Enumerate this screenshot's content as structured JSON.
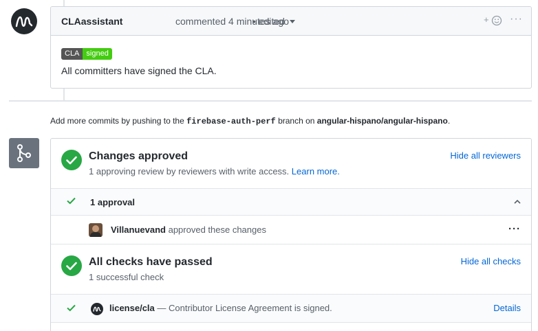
{
  "comment": {
    "author": "CLAassistant",
    "meta": "commented 4 minutes ago",
    "edited": "• edited",
    "badge_left": "CLA",
    "badge_right": "signed",
    "body": "All committers have signed the CLA.",
    "more": "···",
    "reaction": "+"
  },
  "push_info": {
    "prefix": "Add more commits by pushing to the",
    "branch": "firebase-auth-perf",
    "middle": "branch on",
    "repo": "angular-hispano/angular-hispano",
    "suffix": "."
  },
  "reviews": {
    "title": "Changes approved",
    "subtitle": "1 approving review by reviewers with write access.",
    "learn_more": "Learn more.",
    "hide_link": "Hide all reviewers",
    "approval_count": "1 approval",
    "reviewer_name": "Villanuevand",
    "reviewer_action": "approved these changes",
    "more": "···"
  },
  "checks": {
    "title": "All checks have passed",
    "subtitle": "1 successful check",
    "hide_link": "Hide all checks",
    "check_name": "license/cla",
    "check_desc": "— Contributor License Agreement is signed.",
    "details": "Details"
  },
  "colors": {
    "success": "#28a745",
    "link": "#0366d6",
    "badge_green": "#44cc11",
    "badge_gray": "#555555"
  }
}
